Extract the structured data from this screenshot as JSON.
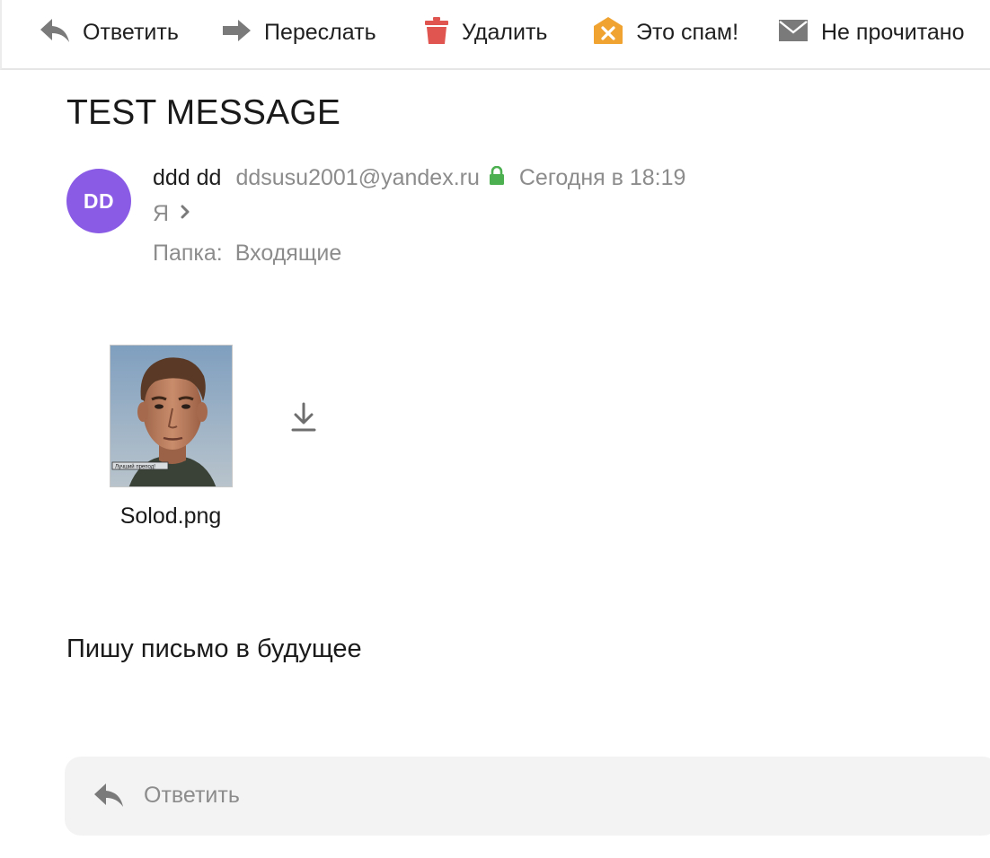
{
  "toolbar": {
    "reply_label": "Ответить",
    "forward_label": "Переслать",
    "delete_label": "Удалить",
    "spam_label": "Это спам!",
    "unread_label": "Не прочитано"
  },
  "message": {
    "subject": "TEST MESSAGE",
    "avatar_initials": "DD",
    "sender_name": "ddd dd",
    "sender_email": "ddsusu2001@yandex.ru",
    "date": "Сегодня в 18:19",
    "recipient": "Я",
    "folder_label": "Папка:",
    "folder_value": "Входящие",
    "body": "Пишу письмо в будущее"
  },
  "attachment": {
    "filename": "Solod.png",
    "thumb_caption": "Лучший препод!"
  },
  "quick_reply": {
    "label": "Ответить"
  },
  "colors": {
    "avatar": "#8a5ce6",
    "delete_icon": "#e0554f",
    "spam_icon": "#f0a330",
    "lock_icon": "#4caf50",
    "icon_gray": "#7a7a7a"
  }
}
